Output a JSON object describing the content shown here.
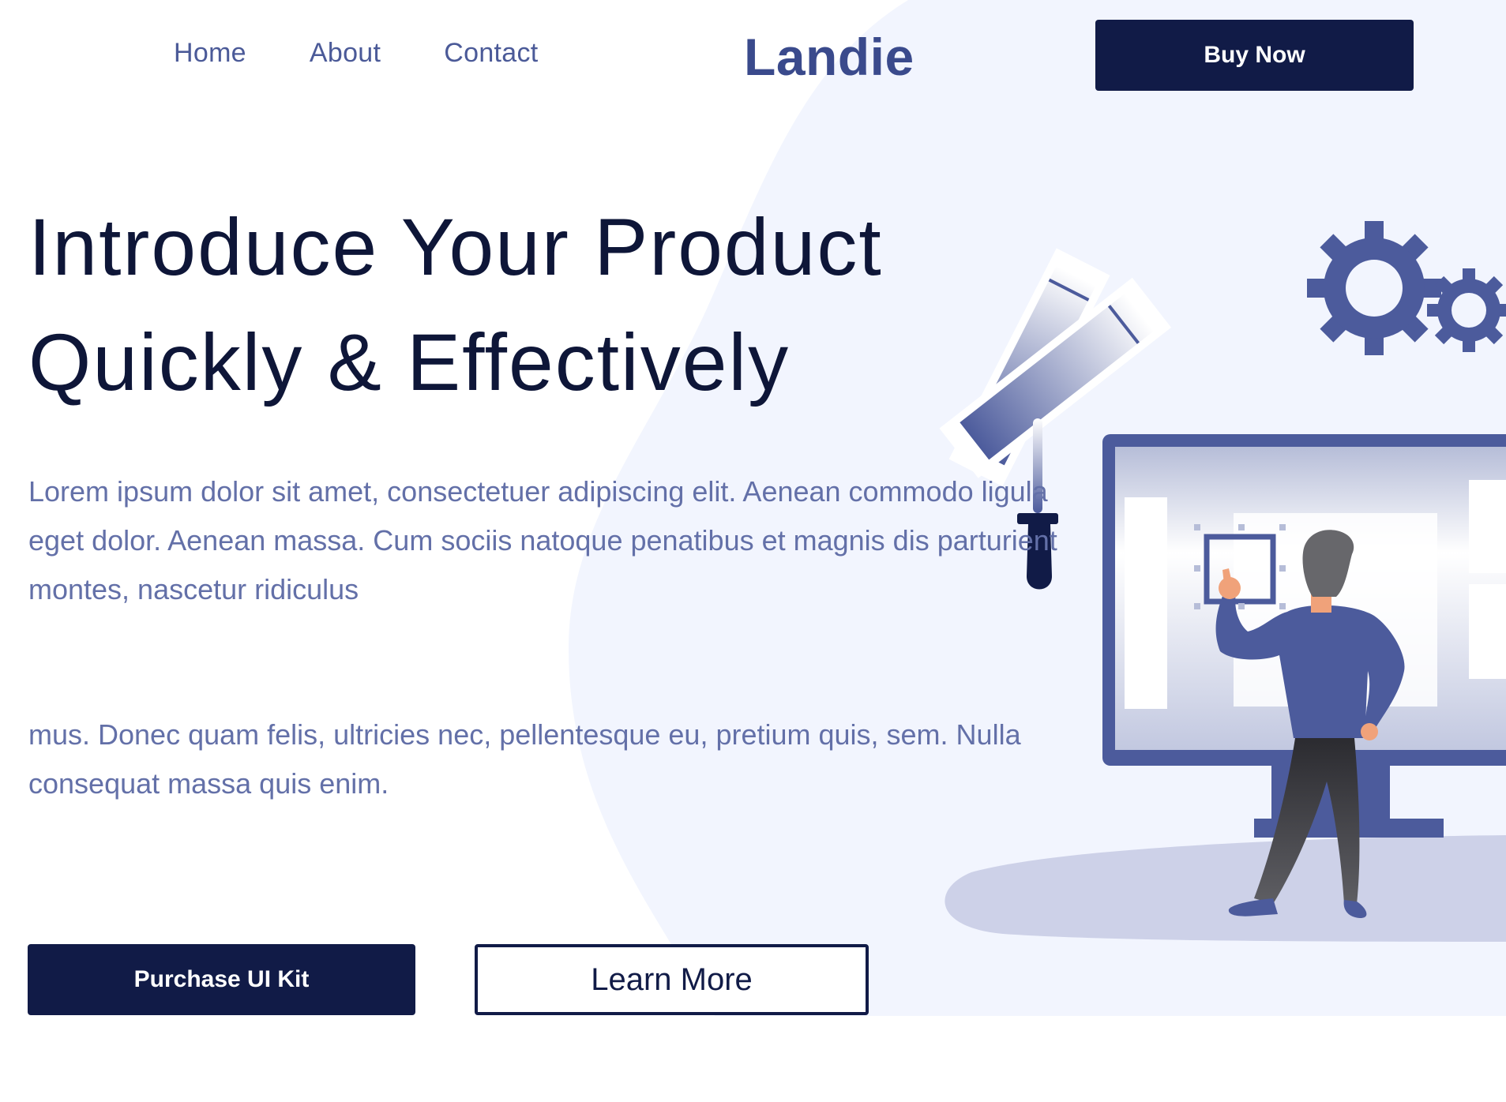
{
  "nav": {
    "links": [
      {
        "label": "Home"
      },
      {
        "label": "About"
      },
      {
        "label": "Contact"
      }
    ],
    "brand": "Landie",
    "buy_label": "Buy Now"
  },
  "hero": {
    "title_line1": "Introduce Your Product",
    "title_line2": "Quickly & Effectively",
    "paragraph1": "Lorem ipsum dolor sit amet, consectetuer adipiscing elit. Aenean commodo ligula eget dolor. Aenean massa. Cum sociis natoque penatibus et magnis dis parturient montes, nascetur ridiculus",
    "paragraph2": "mus. Donec quam felis, ultricies nec, pellentesque eu, pretium quis, sem. Nulla consequat massa quis enim.",
    "primary_button": "Purchase UI Kit",
    "secondary_button": "Learn More"
  },
  "colors": {
    "brand_dark": "#111b47",
    "accent": "#4b5a98",
    "background_tint": "#f2f5fe"
  },
  "icons": [
    "gear-icon",
    "monitor-illustration",
    "color-swatch-illustration",
    "pipette-illustration"
  ]
}
